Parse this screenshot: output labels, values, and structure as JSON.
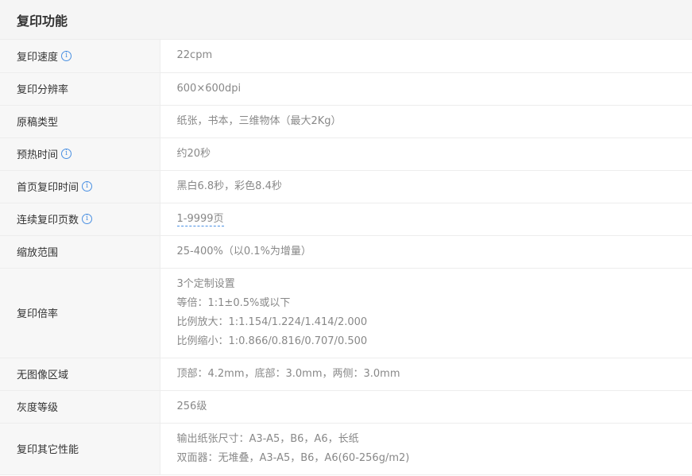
{
  "section": {
    "title": "复印功能"
  },
  "rows": [
    {
      "label": "复印速度",
      "info": true,
      "lines": [
        "22cpm"
      ]
    },
    {
      "label": "复印分辨率",
      "info": false,
      "lines": [
        "600×600dpi"
      ]
    },
    {
      "label": "原稿类型",
      "info": false,
      "lines": [
        "纸张，书本，三维物体（最大2Kg）"
      ]
    },
    {
      "label": "预热时间",
      "info": true,
      "lines": [
        "约20秒"
      ]
    },
    {
      "label": "首页复印时间",
      "info": true,
      "lines": [
        "黑白6.8秒，彩色8.4秒"
      ]
    },
    {
      "label": "连续复印页数",
      "info": true,
      "lines": [
        "1-9999页"
      ],
      "dashed": true
    },
    {
      "label": "缩放范围",
      "info": false,
      "lines": [
        "25-400%（以0.1%为增量）"
      ]
    },
    {
      "label": "复印倍率",
      "info": false,
      "lines": [
        "3个定制设置",
        "等倍：1:1±0.5%或以下",
        "比例放大：1:1.154/1.224/1.414/2.000",
        "比例缩小：1:0.866/0.816/0.707/0.500"
      ]
    },
    {
      "label": "无图像区域",
      "info": false,
      "lines": [
        "顶部：4.2mm，底部：3.0mm，两侧：3.0mm"
      ]
    },
    {
      "label": "灰度等级",
      "info": false,
      "lines": [
        "256级"
      ]
    },
    {
      "label": "复印其它性能",
      "info": false,
      "lines": [
        "输出纸张尺寸：A3-A5，B6，A6，长纸",
        "双面器：无堆叠，A3-A5，B6，A6(60-256g/m2)"
      ]
    }
  ],
  "icons": {
    "info": "info-icon"
  },
  "colors": {
    "accent": "#4a90e2",
    "label_bg": "#f7f7f7",
    "header_bg": "#f5f5f5"
  }
}
